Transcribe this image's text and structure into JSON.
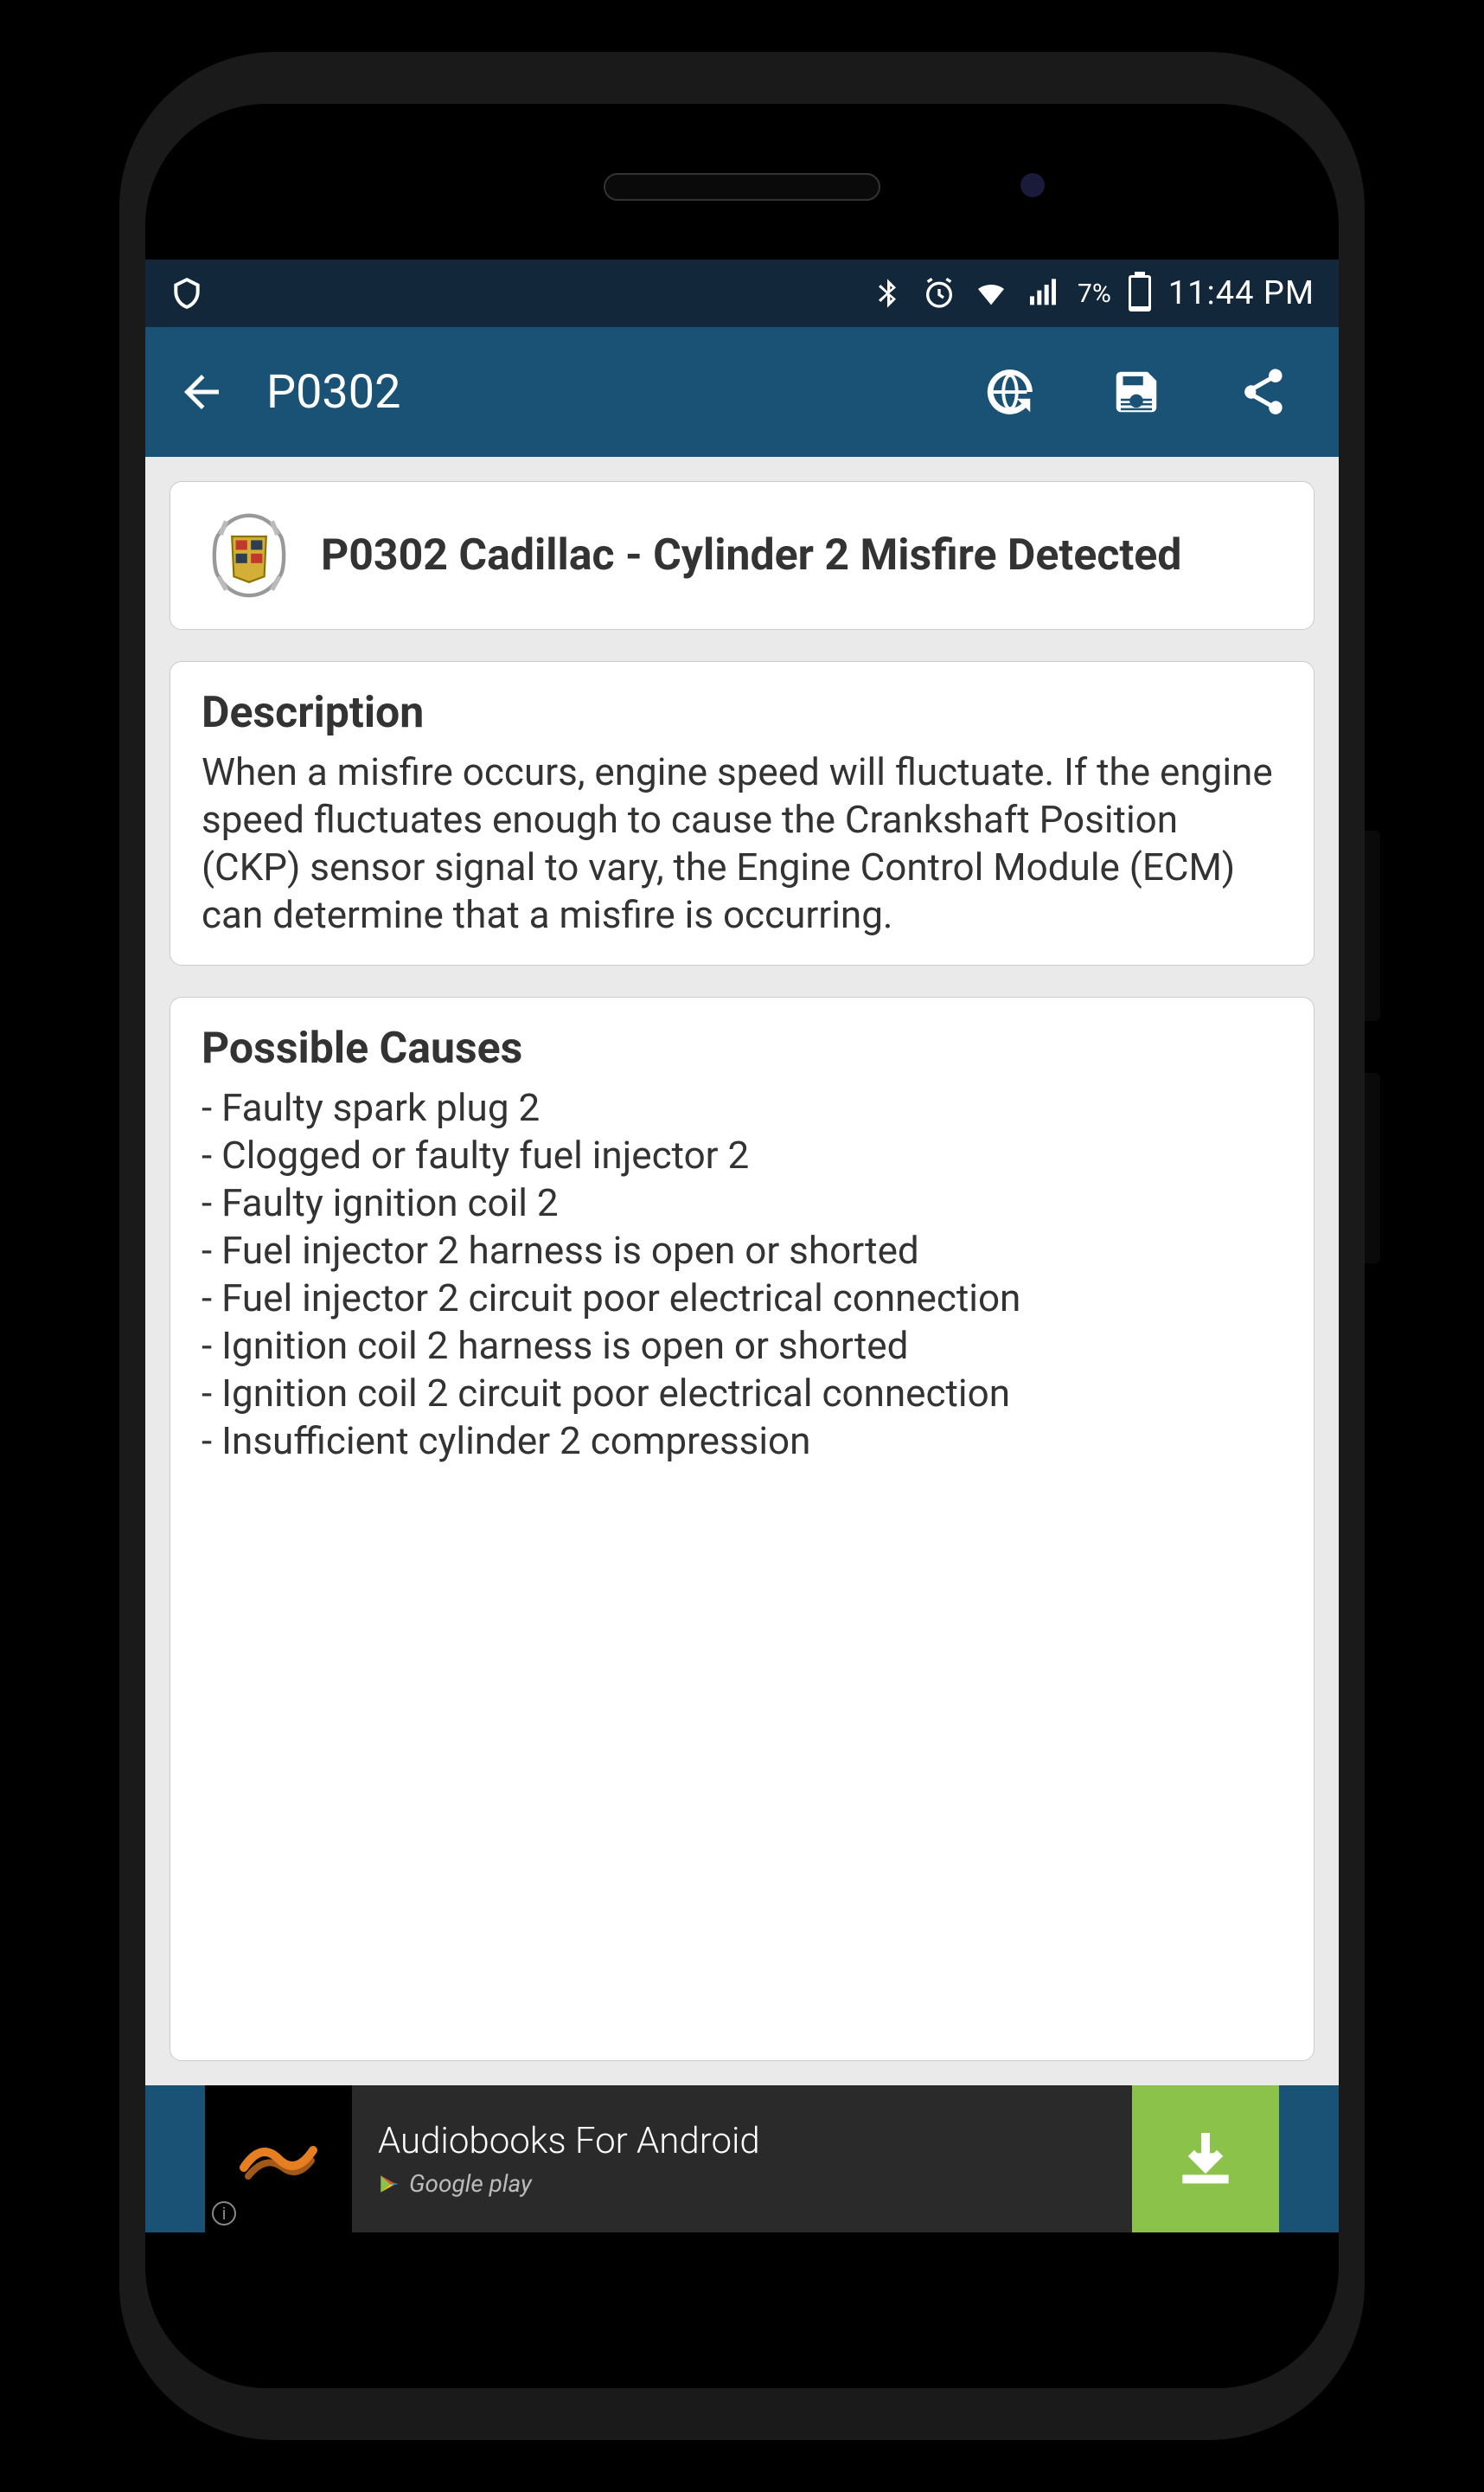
{
  "status_bar": {
    "battery_percent": "7%",
    "time": "11:44 PM"
  },
  "app_bar": {
    "title": "P0302"
  },
  "header_card": {
    "title": "P0302 Cadillac - Cylinder 2 Misfire Detected"
  },
  "description": {
    "heading": "Description",
    "body": "When a misfire occurs, engine speed will fluctuate. If the engine speed fluctuates enough to cause the Crankshaft Position (CKP) sensor signal to vary, the Engine Control Module (ECM) can determine that a misfire is occurring."
  },
  "causes": {
    "heading": "Possible Causes",
    "items": [
      "- Faulty spark plug 2",
      "- Clogged or faulty fuel injector 2",
      "- Faulty ignition coil 2",
      "- Fuel injector 2 harness is open or shorted",
      "- Fuel injector 2 circuit poor electrical connection",
      "- Ignition coil 2 harness is open or shorted",
      "- Ignition coil 2 circuit poor electrical connection",
      "- Insufficient cylinder 2 compression"
    ]
  },
  "ad": {
    "title": "Audiobooks For Android",
    "store": "Google play"
  }
}
